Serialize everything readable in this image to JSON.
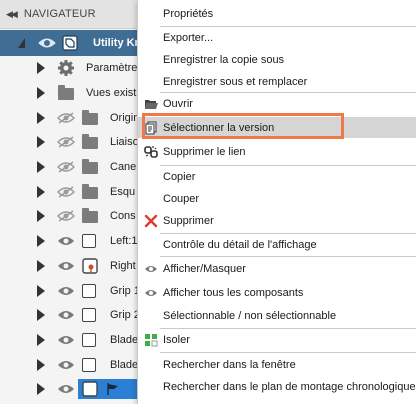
{
  "navigator": {
    "title": "NAVIGATEUR",
    "root": {
      "label": "Utility Kn"
    },
    "rows": [
      {
        "label": "Paramètre",
        "kind": "gear",
        "eye": "none"
      },
      {
        "label": "Vues exist",
        "kind": "folder",
        "eye": "none"
      },
      {
        "label": "Origin",
        "kind": "folder",
        "eye": "hidden"
      },
      {
        "label": "Liaiso",
        "kind": "folder",
        "eye": "hidden"
      },
      {
        "label": "Cane",
        "kind": "folder",
        "eye": "hidden"
      },
      {
        "label": "Esqu",
        "kind": "folder",
        "eye": "hidden"
      },
      {
        "label": "Cons",
        "kind": "folder",
        "eye": "hidden"
      },
      {
        "label": "Left:1",
        "kind": "cube",
        "eye": "visible"
      },
      {
        "label": "Right",
        "kind": "cube-pin",
        "eye": "visible"
      },
      {
        "label": "Grip 1",
        "kind": "cube",
        "eye": "visible"
      },
      {
        "label": "Grip 2",
        "kind": "cube",
        "eye": "visible"
      },
      {
        "label": "Blade",
        "kind": "cube",
        "eye": "visible"
      },
      {
        "label": "Blade",
        "kind": "cube",
        "eye": "visible"
      },
      {
        "label": "",
        "kind": "cube-flag",
        "eye": "visible"
      }
    ]
  },
  "context_menu": {
    "items": [
      {
        "label": "Propriétés",
        "icon": ""
      },
      {
        "label": "Exporter...",
        "icon": ""
      },
      {
        "label": "Enregistrer la copie sous",
        "icon": ""
      },
      {
        "label": "Enregistrer sous et remplacer",
        "icon": ""
      },
      {
        "label": "Ouvrir",
        "icon": "open-folder-icon"
      },
      {
        "label": "Sélectionner la version",
        "icon": "version-icon"
      },
      {
        "label": "Supprimer le lien",
        "icon": "unlink-icon"
      },
      {
        "label": "Copier",
        "icon": ""
      },
      {
        "label": "Couper",
        "icon": ""
      },
      {
        "label": "Supprimer",
        "icon": "delete-x-icon"
      },
      {
        "label": "Contrôle du détail de l'affichage",
        "icon": ""
      },
      {
        "label": "Afficher/Masquer",
        "icon": "eye-icon"
      },
      {
        "label": "Afficher tous les composants",
        "icon": "eye-icon"
      },
      {
        "label": "Sélectionnable / non sélectionnable",
        "icon": ""
      },
      {
        "label": "Isoler",
        "icon": "isolate-icon"
      },
      {
        "label": "Rechercher dans la fenêtre",
        "icon": ""
      },
      {
        "label": "Rechercher dans le plan de montage chronologique",
        "icon": ""
      }
    ],
    "highlight_color": "#ee7a4a"
  }
}
